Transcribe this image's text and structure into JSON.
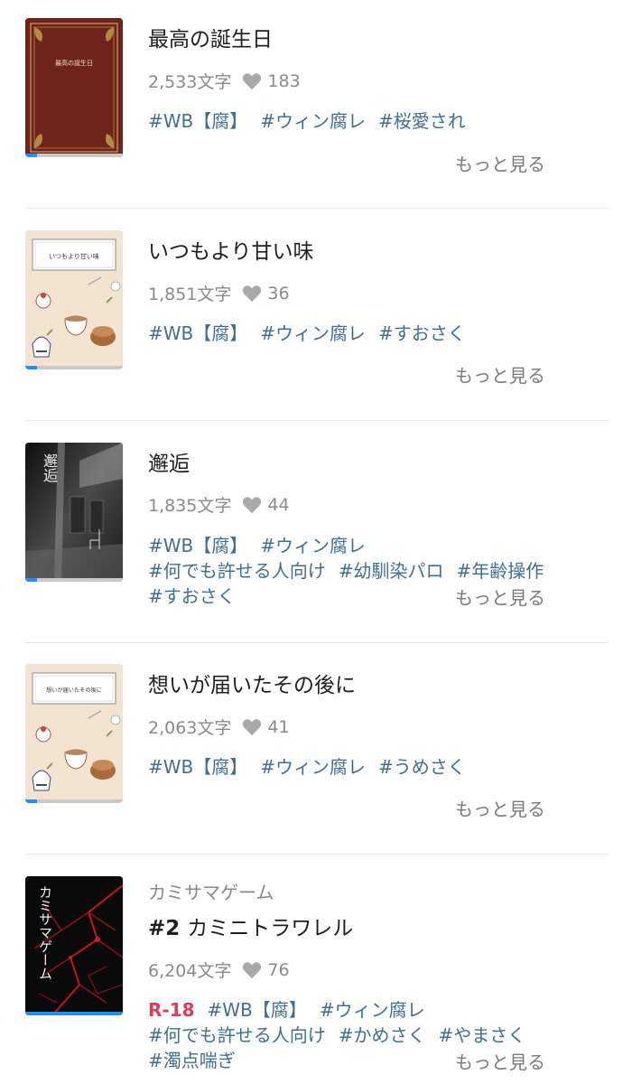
{
  "works": [
    {
      "title": "最高の誕生日",
      "cover_text": "最高の誕生日",
      "chars": "2,533文字",
      "likes": "183",
      "tags": [
        "#WB【腐】",
        "#ウィン腐レ",
        "#桜愛され"
      ],
      "more": "もっと見る",
      "progress": 0.12
    },
    {
      "title": "いつもより甘い味",
      "cover_text": "いつもより甘い味",
      "chars": "1,851文字",
      "likes": "36",
      "tags": [
        "#WB【腐】",
        "#ウィン腐レ",
        "#すおさく"
      ],
      "more": "もっと見る",
      "progress": 0.12
    },
    {
      "title": "邂逅",
      "cover_text": "邂逅",
      "chars": "1,835文字",
      "likes": "44",
      "tags": [
        "#WB【腐】",
        "#ウィン腐レ",
        "#何でも許せる人向け",
        "#幼馴染パロ",
        "#年齢操作",
        "#すおさく"
      ],
      "more": "もっと見る",
      "progress": 0.12
    },
    {
      "title": "想いが届いたその後に",
      "cover_text": "想いが届いたその後に",
      "chars": "2,063文字",
      "likes": "41",
      "tags": [
        "#WB【腐】",
        "#ウィン腐レ",
        "#うめさく"
      ],
      "more": "もっと見る",
      "progress": 0.12
    },
    {
      "series": "カミサマゲーム",
      "episode": "#2",
      "title": "カミニトラワレル",
      "cover_text": "カミサマゲーム",
      "chars": "6,204文字",
      "likes": "76",
      "rating": "R-18",
      "tags": [
        "#WB【腐】",
        "#ウィン腐レ",
        "#何でも許せる人向け",
        "#かめさく",
        "#やまさく",
        "#濁点喘ぎ"
      ],
      "more": "もっと見る",
      "progress": 1.0
    }
  ],
  "colors": {
    "tag": "#3f6f96",
    "r18": "#e0395b",
    "progress": "#1e90ff",
    "meta": "#8a8a8a"
  },
  "icons": {
    "heart": "heart-icon"
  }
}
